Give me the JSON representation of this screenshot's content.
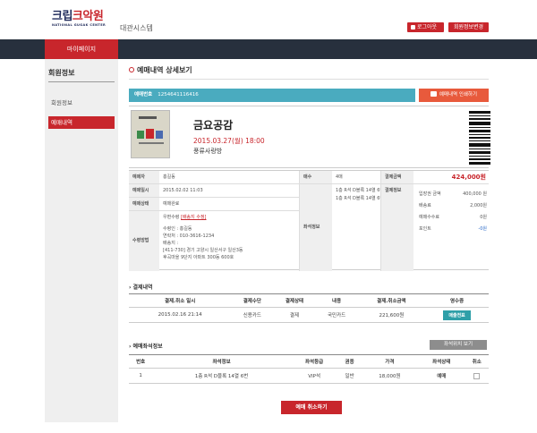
{
  "header": {
    "logo_main_a": "크립",
    "logo_main_b": "크악원",
    "logo_sub": "NATIONAL GUGAK CENTER",
    "system_name": "대관시스템",
    "logout_label": "로그아웃",
    "edit_info_label": "회원정보변경"
  },
  "nav": {
    "mypage_label": "마이페이지"
  },
  "sidebar": {
    "title": "회원정보",
    "items": [
      {
        "label": "회원정보"
      },
      {
        "label": "예매내역"
      }
    ]
  },
  "page": {
    "title": "예매내역 상세보기"
  },
  "reservation": {
    "number_label": "예매번호",
    "number_value": "1254641116416",
    "print_label": "예매내역 인쇄하기"
  },
  "show": {
    "title": "금요공감",
    "date": "2015.03.27(월) 18:00",
    "hall": "풍류사랑방"
  },
  "info": {
    "booker_label": "예매자",
    "booker_value": "홍길동",
    "datetime_label": "예매일시",
    "datetime_value": "2015.02.02 11:03",
    "status_label": "예매상태",
    "status_value": "예매완료",
    "receive_label": "수령방법",
    "receive_method": "우편수령",
    "receive_edit_link": "[배송지 수정]",
    "receiver": "수령인 : 홍길동",
    "phone": "연락처 : 010-3616-1234",
    "address_label": "배송지 :",
    "address_1": "[411-730] 경기 고양시 일산서구 일산3동",
    "address_2": "후곡마을 9단지 아파트 300동 600호",
    "count_label": "매수",
    "count_value": "4매",
    "seat_label": "좌석정보",
    "seat_1": "1층 R석 D블록 14열 6번",
    "seat_2": "1층 R석 D블록 14열 6번",
    "amount_label": "결제금액",
    "amount_value": "424,000원",
    "pay_info_label": "결제정보",
    "pay_rows": [
      {
        "k": "입장권 금액",
        "v": "400,000 원"
      },
      {
        "k": "배송료",
        "v": "2,000원"
      },
      {
        "k": "예매수수료",
        "v": "0원"
      },
      {
        "k": "포인트",
        "v": "-0원"
      }
    ]
  },
  "payment_section": {
    "title": "결제내역",
    "headers": [
      "결제.취소 일시",
      "결제수단",
      "결제상태",
      "내용",
      "결제.취소금액",
      "영수증"
    ],
    "row": {
      "datetime": "2015.02.16  21:14",
      "method": "신용카드",
      "state": "결제",
      "content": "국민카드",
      "amount": "221,600원",
      "receipt_label": "매출전표"
    }
  },
  "seat_section": {
    "title": "예매좌석정보",
    "seat_view_label": "좌석위치 보기",
    "headers": [
      "번호",
      "좌석정보",
      "좌석등급",
      "권종",
      "가격",
      "좌석상태",
      "취소"
    ],
    "row": {
      "no": "1",
      "seat": "1층 R석 D블록 14열 6번",
      "grade": "VIP석",
      "ticket_type": "일반",
      "price": "18,000원",
      "state": "예매"
    }
  },
  "cancel_label": "예매 취소하기",
  "colors": {
    "brand_red": "#c8262c",
    "nav_dark": "#27303d",
    "teal": "#4aabbf",
    "orange": "#e85a3c"
  }
}
